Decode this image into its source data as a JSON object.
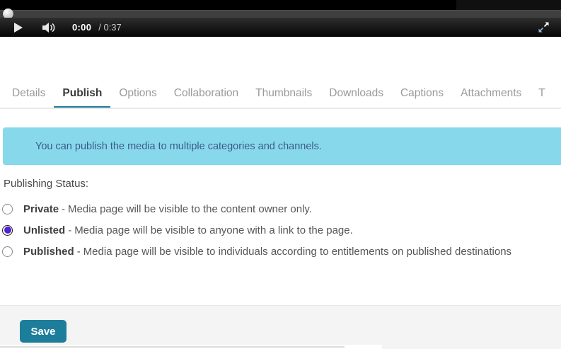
{
  "player": {
    "current_time": "0:00",
    "duration": "/ 0:37",
    "progress_percent": 0,
    "icons": {
      "play": "play-triangle",
      "volume": "speaker-with-waves",
      "fullscreen": "expand-diagonal-arrows"
    }
  },
  "tabs": {
    "items": [
      {
        "label": "Details",
        "active": false
      },
      {
        "label": "Publish",
        "active": true
      },
      {
        "label": "Options",
        "active": false
      },
      {
        "label": "Collaboration",
        "active": false
      },
      {
        "label": "Thumbnails",
        "active": false
      },
      {
        "label": "Downloads",
        "active": false
      },
      {
        "label": "Captions",
        "active": false
      },
      {
        "label": "Attachments",
        "active": false
      },
      {
        "label": "T",
        "active": false
      }
    ]
  },
  "banner": {
    "text": "You can publish the media to multiple categories and channels.",
    "background": "#87d8ea",
    "text_color": "#315a8c"
  },
  "publishing": {
    "heading": "Publishing Status:",
    "options": [
      {
        "label": "Private",
        "separator": "-",
        "description": "Media page will be visible to the content owner only.",
        "selected": false
      },
      {
        "label": "Unlisted",
        "separator": "-",
        "description": "Media page will be visible to anyone with a link to the page.",
        "selected": true
      },
      {
        "label": "Published",
        "separator": "-",
        "description": "Media page will be visible to individuals according to entitlements on published destinations",
        "selected": false
      }
    ]
  },
  "footer": {
    "save_label": "Save"
  },
  "colors": {
    "accent_teal": "#1d7e9b",
    "radio_selected": "#5222d0",
    "banner_background": "#87d8ea",
    "footer_background": "#f4f4f4"
  }
}
